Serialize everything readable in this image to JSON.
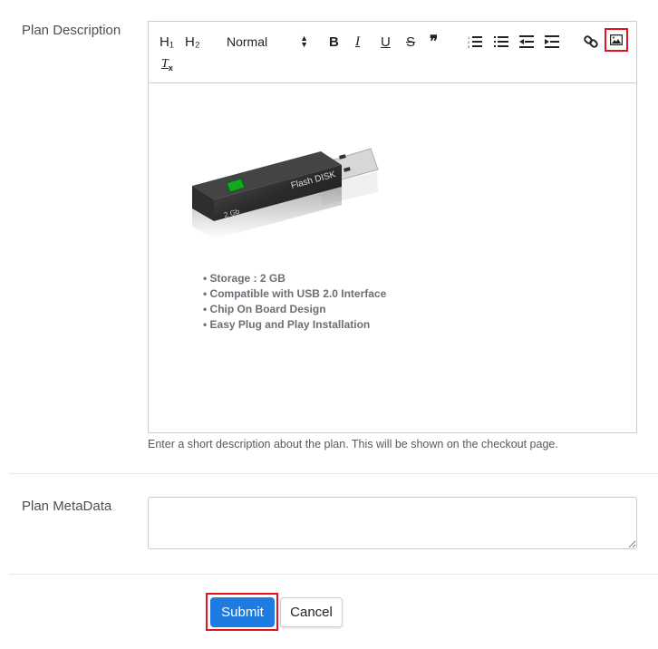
{
  "form": {
    "description_label": "Plan Description",
    "description_help": "Enter a short description about the plan. This will be shown on the checkout page.",
    "metadata_label": "Plan MetaData",
    "metadata_value": "",
    "submit_label": "Submit",
    "cancel_label": "Cancel"
  },
  "toolbar": {
    "h1": "H₁",
    "h2": "H₂",
    "format_select": "Normal",
    "bold": "B",
    "italic": "I",
    "underline": "U",
    "strike": "S",
    "quote": "❞",
    "clear_format": "Tx",
    "highlight_color": "#e0141e"
  },
  "content": {
    "image_alt": "Flash DISK 2 Gb USB drive",
    "usb_label": "Flash DISK",
    "usb_capacity": "2 Gb",
    "bullets": [
      "Storage : 2 GB",
      "Compatible with USB 2.0 Interface",
      "Chip On Board Design",
      "Easy Plug and Play Installation"
    ]
  },
  "colors": {
    "primary": "#1e7be2",
    "highlight": "#e0141e"
  }
}
